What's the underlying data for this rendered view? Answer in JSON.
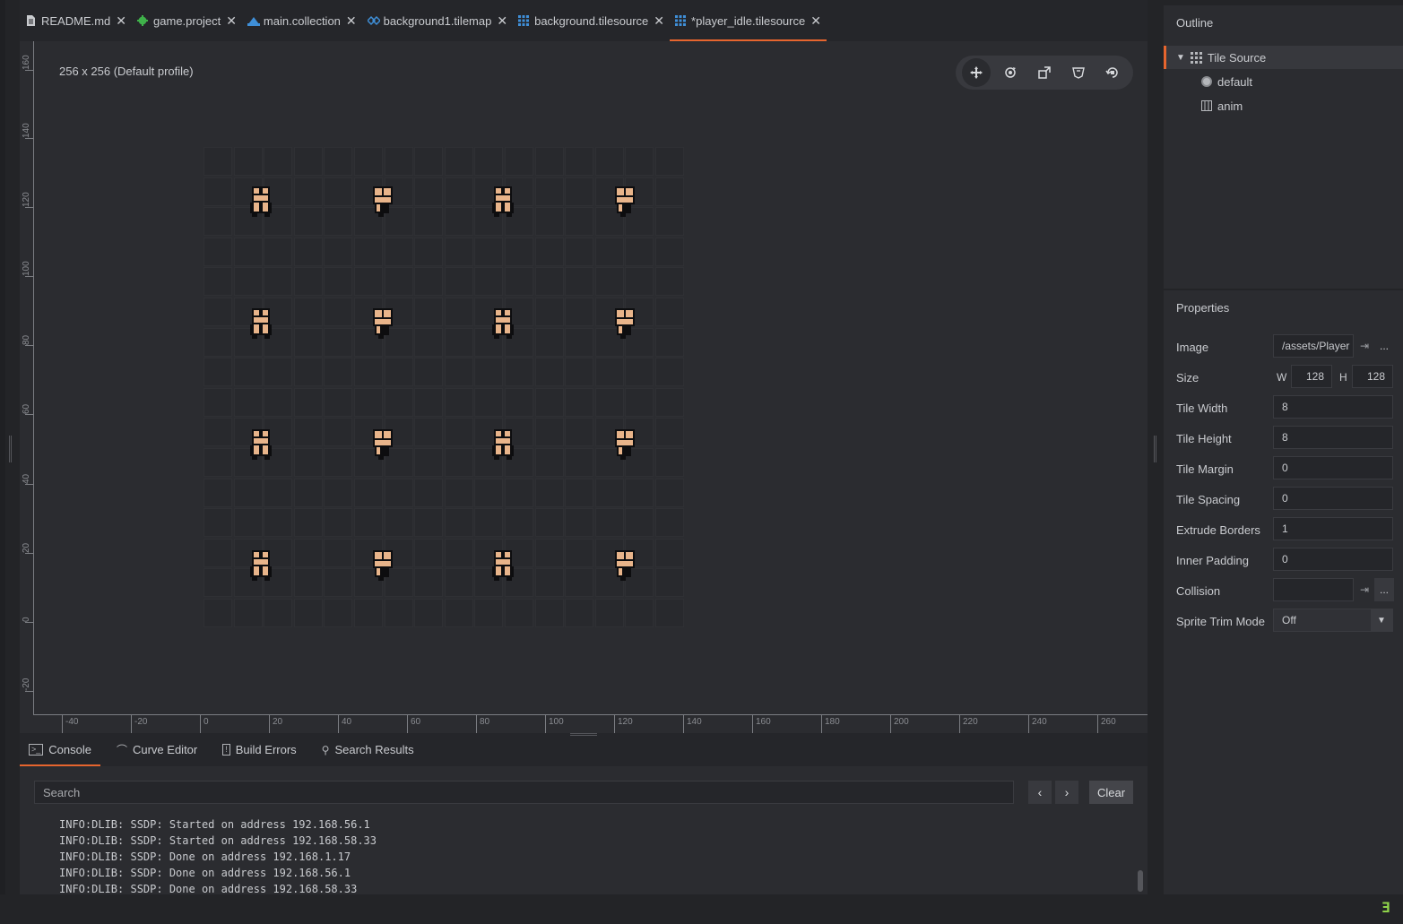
{
  "tabs": [
    {
      "label": "README.md",
      "icon": "document-icon",
      "color": "#c9cbcf"
    },
    {
      "label": "game.project",
      "icon": "gear-icon",
      "color": "#3fb24a"
    },
    {
      "label": "main.collection",
      "icon": "collection-icon",
      "color": "#3f8fd8"
    },
    {
      "label": "background1.tilemap",
      "icon": "tilemap-icon",
      "color": "#3f8fd8"
    },
    {
      "label": "background.tilesource",
      "icon": "tilesource-icon",
      "color": "#3f8fd8"
    },
    {
      "label": "*player_idle.tilesource",
      "icon": "tilesource-icon",
      "color": "#3f8fd8",
      "active": true
    }
  ],
  "viewport": {
    "profile_label": "256 x 256 (Default profile)",
    "toolbar": [
      "move-tool-icon",
      "rotate-tool-icon",
      "scale-tool-icon",
      "visibility-filter-icon",
      "reset-view-icon"
    ]
  },
  "ruler": {
    "vertical": [
      "160",
      "140",
      "120",
      "100",
      "80",
      "60",
      "40",
      "20",
      "0",
      "-20"
    ],
    "horizontal": [
      "-40",
      "-20",
      "0",
      "20",
      "40",
      "60",
      "80",
      "100",
      "120",
      "140",
      "160",
      "180",
      "200",
      "220",
      "240",
      "260"
    ]
  },
  "bottom_tabs": [
    {
      "label": "Console",
      "icon": "console-icon",
      "active": true
    },
    {
      "label": "Curve Editor",
      "icon": "curve-icon"
    },
    {
      "label": "Build Errors",
      "icon": "error-icon"
    },
    {
      "label": "Search Results",
      "icon": "search-icon"
    }
  ],
  "console": {
    "search_placeholder": "Search",
    "prev": "‹",
    "next": "›",
    "clear_label": "Clear",
    "lines": [
      "INFO:DLIB: SSDP: Started on address 192.168.56.1",
      "INFO:DLIB: SSDP: Started on address 192.168.58.33",
      "INFO:DLIB: SSDP: Done on address 192.168.1.17",
      "INFO:DLIB: SSDP: Done on address 192.168.56.1",
      "INFO:DLIB: SSDP: Done on address 192.168.58.33"
    ]
  },
  "outline": {
    "title": "Outline",
    "items": [
      {
        "label": "Tile Source",
        "icon": "grid-icon",
        "level": 0,
        "selected": true,
        "expanded": true
      },
      {
        "label": "default",
        "icon": "collision-group-icon",
        "level": 1
      },
      {
        "label": "anim",
        "icon": "animation-icon",
        "level": 1
      }
    ]
  },
  "properties": {
    "title": "Properties",
    "image_label": "Image",
    "image_value": "/assets/Player",
    "size_label": "Size",
    "size_w_label": "W",
    "size_w": "128",
    "size_h_label": "H",
    "size_h": "128",
    "tile_width_label": "Tile Width",
    "tile_width": "8",
    "tile_height_label": "Tile Height",
    "tile_height": "8",
    "tile_margin_label": "Tile Margin",
    "tile_margin": "0",
    "tile_spacing_label": "Tile Spacing",
    "tile_spacing": "0",
    "extrude_borders_label": "Extrude Borders",
    "extrude_borders": "1",
    "inner_padding_label": "Inner Padding",
    "inner_padding": "0",
    "collision_label": "Collision",
    "collision": "",
    "sprite_trim_mode_label": "Sprite Trim Mode",
    "sprite_trim_mode": "Off",
    "dots": "..."
  },
  "corner_badge": "Ǝ",
  "colors": {
    "accent": "#e6652e",
    "skin": "#e8b48a"
  }
}
